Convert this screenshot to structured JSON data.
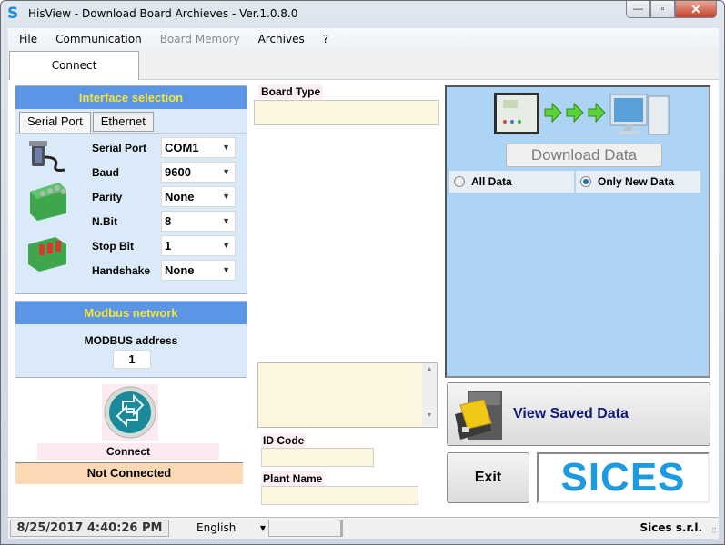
{
  "window": {
    "title": "HisView - Download Board Archieves - Ver.1.0.8.0",
    "app_icon": "S",
    "minimize": "—",
    "maximize": "▫",
    "close": "✕"
  },
  "menu": [
    {
      "label": "File",
      "enabled": true
    },
    {
      "label": "Communication",
      "enabled": true
    },
    {
      "label": "Board Memory",
      "enabled": false
    },
    {
      "label": "Archives",
      "enabled": true
    },
    {
      "label": "?",
      "enabled": true
    }
  ],
  "tabs": [
    {
      "label": "Connect",
      "active": true
    }
  ],
  "interface": {
    "header": "Interface selection",
    "subtabs": [
      {
        "label": "Serial Port",
        "active": true
      },
      {
        "label": "Ethernet",
        "active": false
      }
    ],
    "fields": [
      {
        "label": "Serial Port",
        "value": "COM1"
      },
      {
        "label": "Baud",
        "value": "9600"
      },
      {
        "label": "Parity",
        "value": "None"
      },
      {
        "label": "N.Bit",
        "value": "8"
      },
      {
        "label": "Stop Bit",
        "value": "1"
      },
      {
        "label": "Handshake",
        "value": "None"
      }
    ],
    "dropdown_arrow": "▼"
  },
  "modbus": {
    "header": "Modbus network",
    "address_label": "MODBUS address",
    "address_value": "1"
  },
  "connect": {
    "label": "Connect",
    "status": "Not Connected"
  },
  "board": {
    "board_type_label": "Board Type",
    "board_type_value": "",
    "id_code_label": "ID Code",
    "id_code_value": "",
    "plant_name_label": "Plant Name",
    "plant_name_value": "",
    "scroll_up": "▲",
    "scroll_down": "▼"
  },
  "download": {
    "button": "Download Data",
    "options": [
      {
        "label": "All Data",
        "checked": false
      },
      {
        "label": "Only New Data",
        "checked": true
      }
    ]
  },
  "view_saved": {
    "label": "View Saved Data"
  },
  "exit": {
    "label": "Exit"
  },
  "logo": {
    "text": "SICES"
  },
  "statusbar": {
    "datetime": "8/25/2017 4:40:26 PM",
    "language": "English",
    "company": "Sices s.r.l."
  },
  "colors": {
    "header_blue": "#5b95e6",
    "header_text": "#f2e63a",
    "panel_bg": "#daeaf8",
    "download_panel": "#aed4f5",
    "not_connected_bg": "#fcd9b4",
    "logo_blue": "#1c9be0"
  }
}
